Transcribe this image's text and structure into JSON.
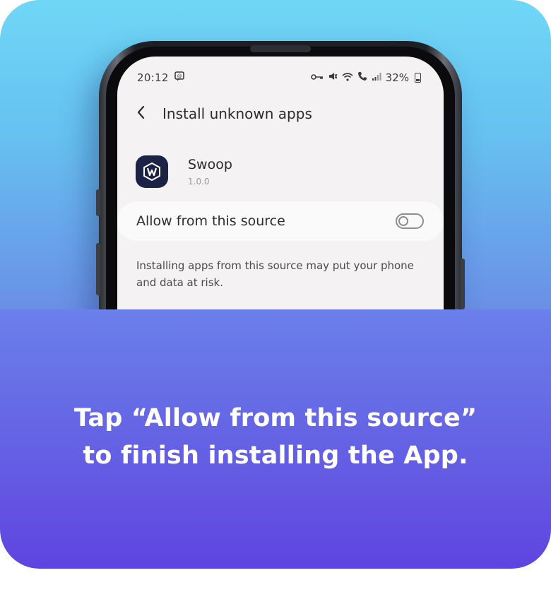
{
  "status_bar": {
    "time": "20:12",
    "battery": "32%",
    "icons": [
      "message-notification-icon",
      "key-icon",
      "mute-icon",
      "wifi-icon",
      "call-icon",
      "signal-icon",
      "battery-icon"
    ]
  },
  "header": {
    "title": "Install unknown apps"
  },
  "app": {
    "name": "Swoop",
    "version": "1.0.0",
    "icon": "swoop-logo-icon",
    "icon_color": "#1c2146"
  },
  "setting": {
    "label": "Allow from this source",
    "enabled": false
  },
  "warning": "Installing apps from this source may put your phone and data at risk.",
  "caption": {
    "line1": "Tap “Allow from this source”",
    "line2": "to finish installing the App."
  },
  "colors": {
    "card_top": "#6fd7f6",
    "card_bottom": "#5f44e0",
    "screen_bg": "#f4f2f3"
  }
}
